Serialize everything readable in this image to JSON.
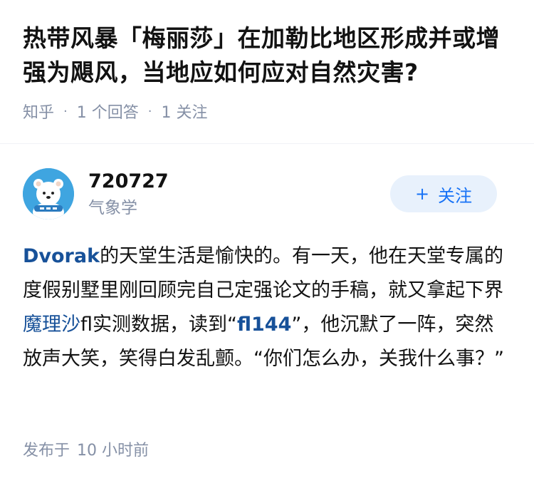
{
  "question": {
    "title": "热带风暴「梅丽莎」在加勒比地区形成并或增强为飓风，当地应如何应对自然灾害?",
    "source": "知乎",
    "answer_count": "1 个回答",
    "follower_count": "1 关注"
  },
  "author": {
    "name": "720727",
    "description": "气象学",
    "follow_label": "关注",
    "follow_plus": "+"
  },
  "answer": {
    "segments": [
      {
        "text": "Dvorak",
        "style": "link-bold"
      },
      {
        "text": "的天堂生活是愉快的。有一天，他在天堂专属的度假别墅里刚回顾完自己定强论文的手稿，就又拿起下界",
        "style": "plain"
      },
      {
        "text": "魔理沙",
        "style": "link"
      },
      {
        "text": "fl实测数据，读到“",
        "style": "plain"
      },
      {
        "text": "fl144",
        "style": "link-bold"
      },
      {
        "text": "”，他沉默了一阵，突然放声大笑，笑得白发乱颤。“你们怎么办，关我什么事？”",
        "style": "plain"
      }
    ]
  },
  "footer": {
    "label": "发布于",
    "time": "10 小时前"
  },
  "colors": {
    "link": "#175199",
    "accent": "#1772f6",
    "follow_bg": "#e8f1fc",
    "meta": "#8590a6",
    "avatar_bg": "#3fa5e0"
  },
  "icons": {
    "avatar": "cartoon-bear-avatar-icon"
  }
}
